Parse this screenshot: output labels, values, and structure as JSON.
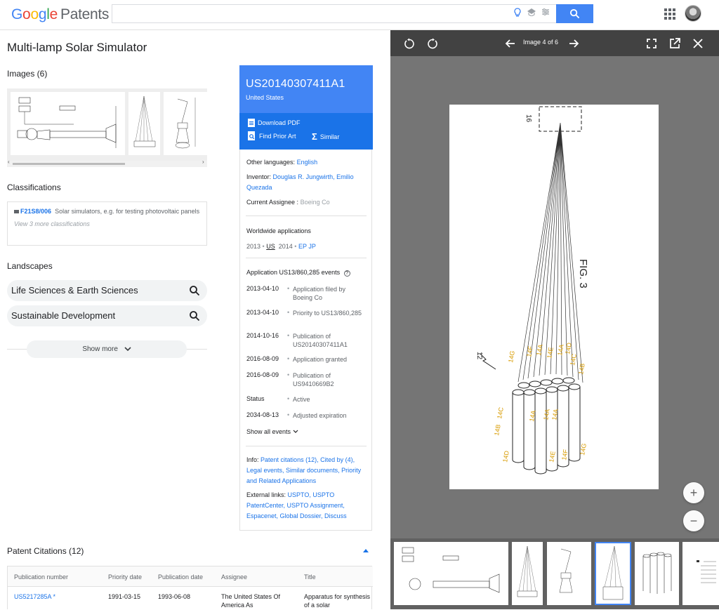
{
  "header": {
    "logo_google": "Google",
    "logo_patents": "Patents",
    "search_value": ""
  },
  "left": {
    "title": "Multi-lamp Solar Simulator",
    "images_heading": "Images (6)",
    "classifications_heading": "Classifications",
    "classification": {
      "code": "F21S8/006",
      "description": "Solar simulators, e.g. for testing photovoltaic panels",
      "more": "View 3 more classifications"
    },
    "landscapes_heading": "Landscapes",
    "landscapes": [
      "Life Sciences & Earth Sciences",
      "Sustainable Development"
    ],
    "show_more": "Show more"
  },
  "card": {
    "number": "US20140307411A1",
    "country": "United States",
    "download_pdf": "Download PDF",
    "find_prior_art": "Find Prior Art",
    "similar": "Similar",
    "other_languages_label": "Other languages:",
    "other_languages_value": "English",
    "inventor_label": "Inventor:",
    "inventor_value": "Douglas R. Jungwirth, Emilio Quezada",
    "assignee_label": "Current Assignee",
    "assignee_value": "Boeing Co",
    "worldwide_label": "Worldwide applications",
    "worldwide": {
      "y1": "2013",
      "c1": "US",
      "y2": "2014",
      "c2": "EP JP"
    },
    "events_label": "Application US13/860,285 events",
    "events": [
      {
        "date": "2013-04-10",
        "text": "Application filed by Boeing Co"
      },
      {
        "date": "2013-04-10",
        "text": "Priority to US13/860,285"
      },
      {
        "date": "2014-10-16",
        "text": "Publication of US20140307411A1"
      },
      {
        "date": "2016-08-09",
        "text": "Application granted"
      },
      {
        "date": "2016-08-09",
        "text": "Publication of US9410669B2"
      },
      {
        "date": "Status",
        "text": "Active"
      },
      {
        "date": "2034-08-13",
        "text": "Adjusted expiration"
      }
    ],
    "show_all_events": "Show all events",
    "info_label": "Info:",
    "info_links": "Patent citations (12), Cited by (4), Legal events, Similar documents, Priority and Related Applications",
    "external_label": "External links:",
    "external_links": "USPTO, USPTO PatentCenter, USPTO Assignment, Espacenet, Global Dossier, Discuss"
  },
  "citations": {
    "heading": "Patent Citations (12)",
    "columns": [
      "Publication number",
      "Priority date",
      "Publication date",
      "Assignee",
      "Title"
    ],
    "rows": [
      {
        "number": "US5217285A *",
        "priority": "1991-03-15",
        "publication": "1993-06-08",
        "assignee": "The United States Of America As",
        "title": "Apparatus for synthesis of a solar"
      }
    ]
  },
  "viewer": {
    "image_counter": "Image 4 of 6",
    "fig_label": "FIG. 3",
    "labels": {
      "l16": "16",
      "l12": "12",
      "l14A": "14A",
      "l14B": "14B",
      "l14C": "14C",
      "l14D": "14D",
      "l14E": "14E",
      "l14F": "14F",
      "l14G": "14G"
    },
    "zoom_in": "+",
    "zoom_out": "−"
  }
}
